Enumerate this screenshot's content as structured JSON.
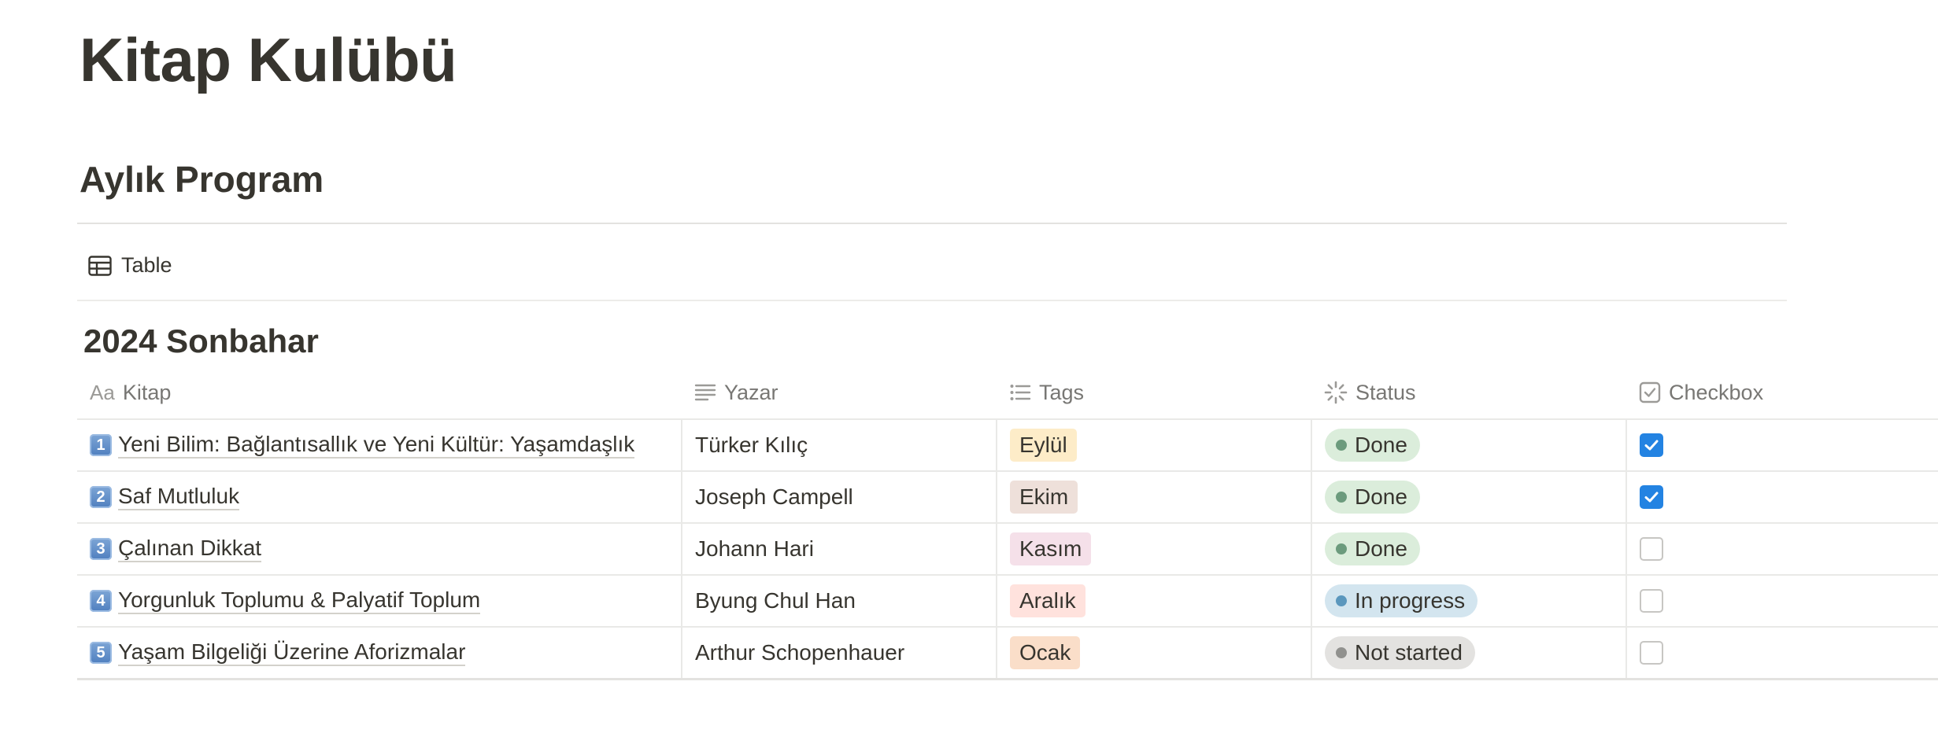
{
  "page": {
    "title": "Kitap Kulübü",
    "section_heading": "Aylık Program"
  },
  "view": {
    "tab_label": "Table",
    "tab_icon": "table-icon"
  },
  "group": {
    "title": "2024 Sonbahar"
  },
  "columns": [
    {
      "label": "Kitap",
      "icon": "text-aa-icon"
    },
    {
      "label": "Yazar",
      "icon": "text-lines-icon"
    },
    {
      "label": "Tags",
      "icon": "list-icon"
    },
    {
      "label": "Status",
      "icon": "status-spinner-icon"
    },
    {
      "label": "Checkbox",
      "icon": "checkbox-icon"
    }
  ],
  "rows": [
    {
      "num": "1",
      "kitap": "Yeni Bilim: Bağlantısallık ve Yeni Kültür: Yaşamdaşlık",
      "yazar": "Türker Kılıç",
      "tag": "Eylül",
      "tag_bg": "#fdecc8",
      "status": "Done",
      "status_kind": "done",
      "checked": true
    },
    {
      "num": "2",
      "kitap": "Saf Mutluluk",
      "yazar": "Joseph Campell",
      "tag": "Ekim",
      "tag_bg": "#eee0da",
      "status": "Done",
      "status_kind": "done",
      "checked": true
    },
    {
      "num": "3",
      "kitap": "Çalınan Dikkat",
      "yazar": "Johann Hari",
      "tag": "Kasım",
      "tag_bg": "#f5e0e9",
      "status": "Done",
      "status_kind": "done",
      "checked": false
    },
    {
      "num": "4",
      "kitap": "Yorgunluk Toplumu & Palyatif Toplum",
      "yazar": "Byung Chul Han",
      "tag": "Aralık",
      "tag_bg": "#ffe2dd",
      "status": "In progress",
      "status_kind": "progress",
      "checked": false
    },
    {
      "num": "5",
      "kitap": "Yaşam Bilgeliği Üzerine Aforizmalar",
      "yazar": "Arthur Schopenhauer",
      "tag": "Ocak",
      "tag_bg": "#fadec9",
      "status": "Not started",
      "status_kind": "not-started",
      "checked": false
    }
  ],
  "status_colors": {
    "done": {
      "bg": "#dbeddb",
      "dot": "#6c9b7d"
    },
    "progress": {
      "bg": "#d3e5ef",
      "dot": "#5b97bd"
    },
    "not-started": {
      "bg": "#e3e2e0",
      "dot": "#91918e"
    }
  },
  "checkbox_color": "#2383e2"
}
